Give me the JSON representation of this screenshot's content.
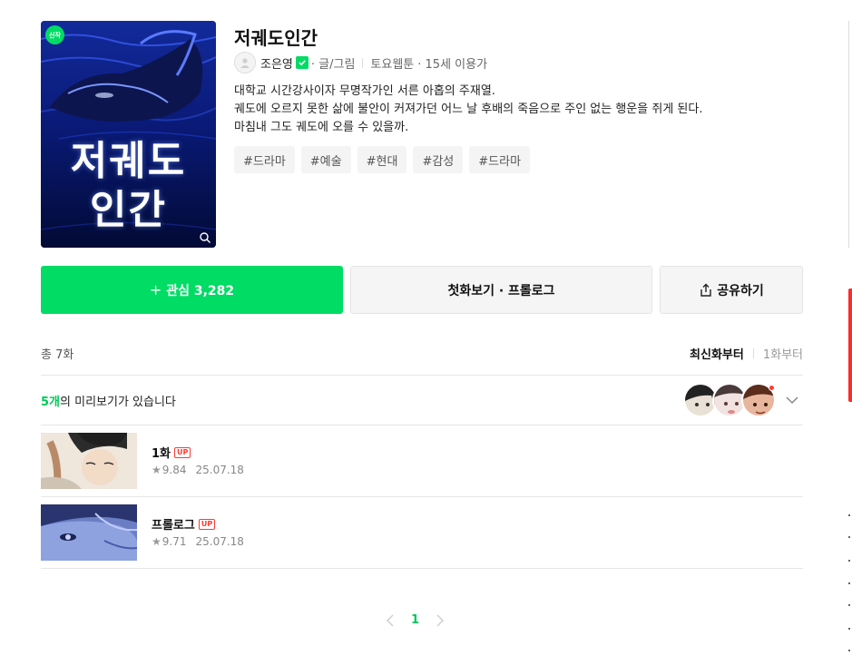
{
  "series": {
    "badge": "신작",
    "cover_title_line1": "저궤도",
    "cover_title_line2": "인간",
    "title": "저궤도인간",
    "author": "조은영",
    "author_role": "· 글/그림",
    "day": "토요웹툰",
    "age": "· 15세 이용가",
    "description": [
      "대학교 시간강사이자 무명작가인 서른 아홉의 주재열.",
      "궤도에 오르지 못한 삶에 불안이 커져가던 어느 날 후배의 죽음으로 주인 없는 행운을 쥐게 된다.",
      "마침내 그도 궤도에 오를 수 있을까."
    ],
    "tags": [
      "#드라마",
      "#예술",
      "#현대",
      "#감성",
      "#드라마"
    ]
  },
  "actions": {
    "favorite_plus": "+",
    "favorite_label": "관심 3,282",
    "first_episode_label": "첫화보기 · 프롤로그",
    "share_label": "공유하기"
  },
  "list": {
    "total": "총 7화",
    "sort_latest": "최신화부터",
    "sort_first": "1화부터",
    "preview_count": "5개",
    "preview_text": "의 미리보기가 있습니다",
    "episodes": [
      {
        "title": "1화",
        "badge": "UP",
        "rating": "9.84",
        "date": "25.07.18"
      },
      {
        "title": "프롤로그",
        "badge": "UP",
        "rating": "9.71",
        "date": "25.07.18"
      }
    ]
  },
  "pagination": {
    "current": "1"
  },
  "colors": {
    "accent": "#00dc64",
    "up_badge": "#ff3b30"
  }
}
